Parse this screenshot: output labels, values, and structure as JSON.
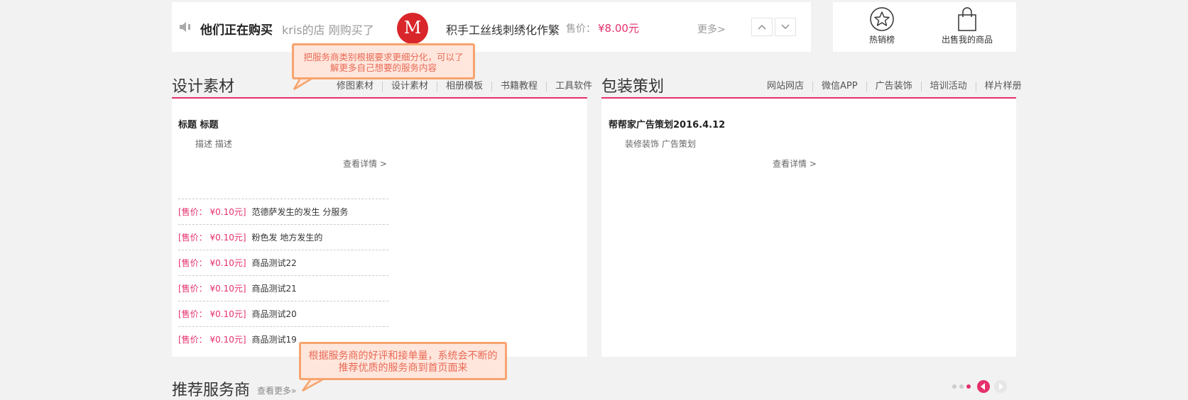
{
  "ticker": {
    "title": "他们正在购买",
    "buyer": "kris的店 刚购买了",
    "logo_letter": "M",
    "product": "积手工丝线刺绣化作繁",
    "price_label": "售价：",
    "price": "¥8.00元",
    "more": "更多>"
  },
  "quick_links": [
    {
      "label": "热销榜",
      "icon": "star-icon"
    },
    {
      "label": "出售我的商品",
      "icon": "shopping-bag-icon"
    }
  ],
  "callouts": {
    "top": "把服务商类别根据要求更细分化，可以了解更多自己想要的服务内容",
    "bottom": "根据服务商的好评和接单量，系统会不断的推荐优质的服务商到首页面来"
  },
  "design": {
    "title": "设计素材",
    "tabs": [
      "修图素材",
      "设计素材",
      "相册模板",
      "书籍教程",
      "工具软件"
    ],
    "post_title": "标题 标题",
    "post_desc": "描述 描述",
    "post_more": "查看详情 >",
    "items": [
      {
        "price": "[售价： ¥0.10元]",
        "name": "范德萨发生的发生 分服务"
      },
      {
        "price": "[售价： ¥0.10元]",
        "name": "粉色发 地方发生的"
      },
      {
        "price": "[售价： ¥0.10元]",
        "name": "商品测试22"
      },
      {
        "price": "[售价： ¥0.10元]",
        "name": "商品测试21"
      },
      {
        "price": "[售价： ¥0.10元]",
        "name": "商品测试20"
      },
      {
        "price": "[售价： ¥0.10元]",
        "name": "商品测试19"
      }
    ]
  },
  "packaging": {
    "title": "包装策划",
    "tabs": [
      "网站网店",
      "微信APP",
      "广告装饰",
      "培训活动",
      "样片样册"
    ],
    "post_title": "帮帮家广告策划2016.4.12",
    "post_desc": "装修装饰 广告策划",
    "post_more": "查看详情 >"
  },
  "recommend": {
    "title": "推荐服务商",
    "more": "查看更多»"
  },
  "colors": {
    "accent": "#e5306b",
    "callout_border": "#f6a46e",
    "callout_fill": "#ffe6dc"
  }
}
